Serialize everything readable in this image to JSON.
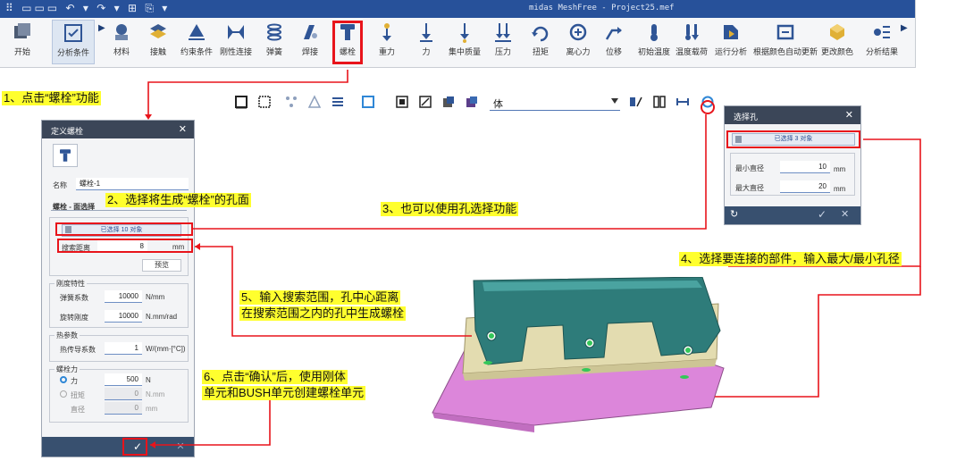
{
  "window": {
    "quick_access": "⠿ ▭▭▭ ↶ ▾ ↷ ▾ ⊞ ⎘ ▾",
    "title": "midas MeshFree - Project25.mef"
  },
  "ribbon": {
    "items": [
      {
        "label": "开始",
        "icon": "start-icon"
      },
      {
        "label": "分析条件",
        "icon": "analysis-condition-icon"
      },
      {
        "label": "材料",
        "icon": "material-icon"
      },
      {
        "label": "接触",
        "icon": "contact-icon"
      },
      {
        "label": "约束条件",
        "icon": "constraint-icon"
      },
      {
        "label": "刚性连接",
        "icon": "rigid-link-icon"
      },
      {
        "label": "弹簧",
        "icon": "spring-icon"
      },
      {
        "label": "焊接",
        "icon": "weld-icon"
      },
      {
        "label": "螺栓",
        "icon": "bolt-icon"
      },
      {
        "label": "重力",
        "icon": "gravity-icon"
      },
      {
        "label": "力",
        "icon": "force-icon"
      },
      {
        "label": "集中质量",
        "icon": "lumped-mass-icon"
      },
      {
        "label": "压力",
        "icon": "pressure-icon"
      },
      {
        "label": "扭矩",
        "icon": "torque-icon"
      },
      {
        "label": "离心力",
        "icon": "centrifugal-icon"
      },
      {
        "label": "位移",
        "icon": "displacement-icon"
      },
      {
        "label": "初始温度",
        "icon": "initial-temp-icon"
      },
      {
        "label": "温度载荷",
        "icon": "temp-load-icon"
      },
      {
        "label": "运行分析",
        "icon": "run-analysis-icon"
      },
      {
        "label": "根据颜色自动更新",
        "icon": "color-auto-update-icon"
      },
      {
        "label": "更改颜色",
        "icon": "change-color-icon"
      },
      {
        "label": "分析结果",
        "icon": "analysis-result-icon"
      }
    ]
  },
  "view_toolbar": {
    "filter_value": "体"
  },
  "bolt_dialog": {
    "title": "定义螺栓",
    "name_label": "名称",
    "name_value": "螺栓-1",
    "tab": "螺栓 - 面选择",
    "selected": "已选择 10 对象",
    "search_label": "搜索距离",
    "search_value": "8",
    "search_unit": "mm",
    "preview": "预览",
    "stiffness_group": "刚度特性",
    "spring_label": "弹簧系数",
    "spring_value": "10000",
    "spring_unit": "N/mm",
    "rot_label": "旋转刚度",
    "rot_value": "10000",
    "rot_unit": "N.mm/rad",
    "heat_group": "热参数",
    "heat_label": "热传导系数",
    "heat_value": "1",
    "heat_unit": "W/(mm·[°C])",
    "pretension_group": "螺栓力",
    "force_label": "力",
    "force_value": "500",
    "force_unit": "N",
    "torque_label": "扭矩",
    "torque_value": "0",
    "torque_unit": "N.mm",
    "diameter_label": "直径",
    "diameter_value": "0",
    "diameter_unit": "mm"
  },
  "hole_dialog": {
    "title": "选择孔",
    "selected": "已选择 3 对象",
    "min_label": "最小直径",
    "min_value": "10",
    "max_label": "最大直径",
    "max_value": "20",
    "unit": "mm"
  },
  "annotations": {
    "step1": "1、点击“螺栓”功能",
    "step2": "2、选择将生成“螺栓”的孔面",
    "step3": "3、也可以使用孔选择功能",
    "step4": "4、选择要连接的部件，输入最大/最小孔径",
    "step5_line1": "5、输入搜索范围，孔中心距离",
    "step5_line2": "在搜索范围之内的孔中生成螺栓",
    "step6_line1": "6、点击“确认”后，使用刚体",
    "step6_line2": "单元和BUSH单元创建螺栓单元"
  },
  "colors": {
    "title_bar": "#27519a",
    "annotation_bg": "#ffff2e",
    "highlight_red": "#e8141b",
    "part_teal": "#2e7c7a",
    "part_khaki": "#e3dcb0",
    "part_pink": "#dc86da"
  }
}
